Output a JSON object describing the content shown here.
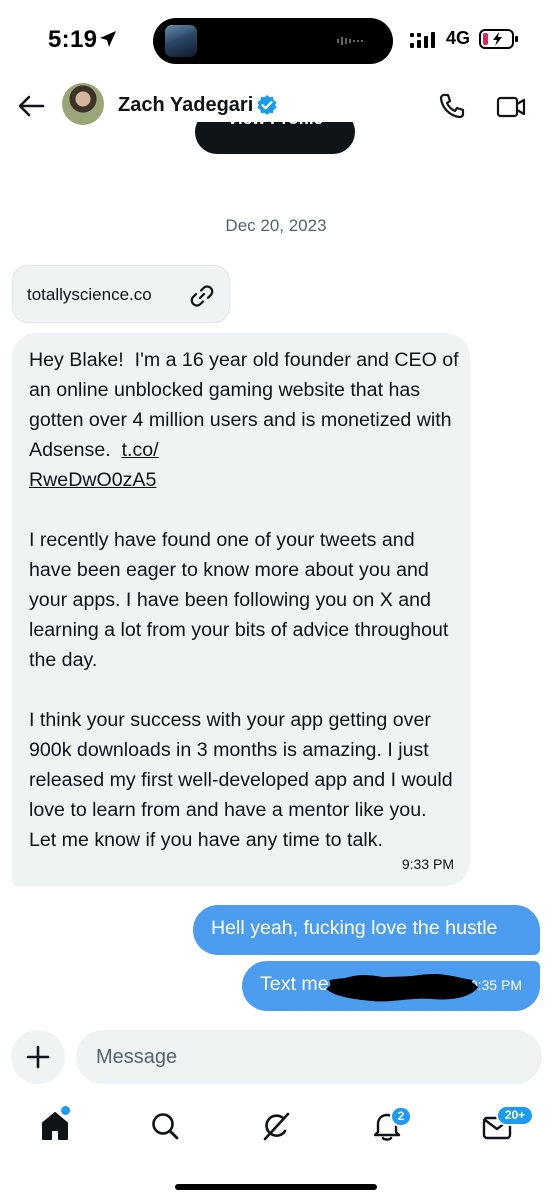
{
  "status_bar": {
    "time": "5:19",
    "network": "4G",
    "icons": [
      "location-arrow-icon",
      "signal-icon",
      "battery-charging-icon"
    ]
  },
  "header": {
    "contact_name": "Zach Yadegari",
    "view_profile_label": "View Profile",
    "icons": [
      "back-arrow-icon",
      "verified-icon",
      "phone-icon",
      "video-icon"
    ]
  },
  "conversation": {
    "date_separator": "Dec 20, 2023",
    "link_card": {
      "text": "totallyscience.co",
      "icon": "link-icon"
    },
    "incoming_message": {
      "text_part1": "Hey Blake!  I'm a 16 year old founder and CEO of an online unblocked gaming website that has gotten over 4 million users and is monetized with Adsense.  ",
      "link": "t.co/\nRweDwO0zA5",
      "text_part2": "\n\nI recently have found one of your tweets and have been eager to know more about you and your apps. I have been following you on X and learning a lot from your bits of advice throughout the day.\n\nI think your success with your app getting over 900k downloads in 3 months is amazing. I just released my first well-developed app and I would love to learn from and have a mentor like you. Let me know if you have any time to talk.",
      "time": "9:33 PM"
    },
    "outgoing_messages": [
      {
        "text": "Hell yeah, fucking love the hustle"
      },
      {
        "text": "Text me",
        "time": "10:35 PM",
        "redacted": true
      }
    ]
  },
  "composer": {
    "placeholder": "Message",
    "value": "",
    "add_icon": "plus-icon"
  },
  "tab_bar": {
    "items": [
      {
        "name": "home",
        "icon": "home-icon",
        "has_dot": true
      },
      {
        "name": "search",
        "icon": "search-icon"
      },
      {
        "name": "grok",
        "icon": "grok-icon"
      },
      {
        "name": "notifications",
        "icon": "bell-icon",
        "badge": "2"
      },
      {
        "name": "messages",
        "icon": "mail-icon",
        "badge": "20+"
      }
    ]
  },
  "colors": {
    "accent": "#1d9bf0",
    "outgoing_bubble": "#4c9df0",
    "incoming_bubble": "#eff3f4",
    "secondary_text": "#536471"
  }
}
